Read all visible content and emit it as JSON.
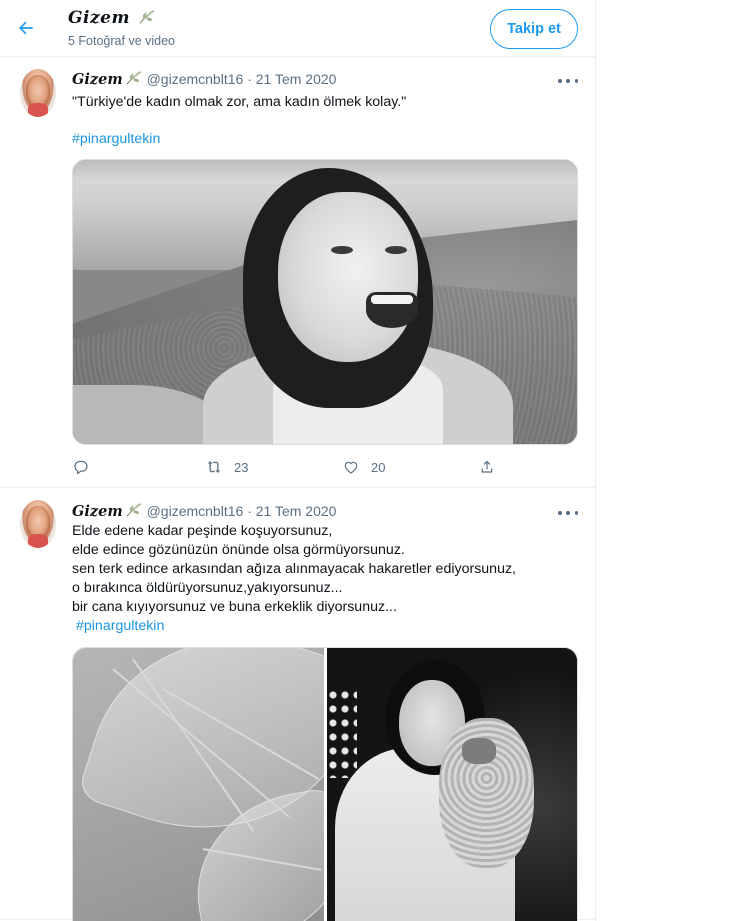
{
  "header": {
    "title": "Gizem",
    "subtitle": "5 Fotoğraf ve video",
    "follow_label": "Takip et"
  },
  "tweets": [
    {
      "display_name": "Gizem",
      "handle": "@gizemcnblt16",
      "separator": "·",
      "date": "21 Tem 2020",
      "text_lines": [
        "\"Türkiye'de kadın olmak zor, ama kadın ölmek kolay.\""
      ],
      "hashtag": "#pinargultekin",
      "replies": "",
      "retweets": "23",
      "likes": "20"
    },
    {
      "display_name": "Gizem",
      "handle": "@gizemcnblt16",
      "separator": "·",
      "date": "21 Tem 2020",
      "text_lines": [
        "Elde edene kadar peşinde koşuyorsunuz,",
        "elde edince gözünüzün önünde olsa görmüyorsunuz.",
        "sen terk edince arkasından ağıza alınmayacak hakaretler ediyorsunuz,",
        "o bırakınca öldürüyorsunuz,yakıyorsunuz...",
        "bir cana kıyıyorsunuz ve buna erkeklik diyorsunuz..."
      ],
      "hashtag": "#pinargultekin"
    }
  ],
  "icons": {
    "back": "arrow-left-icon",
    "leaf": "leaf-icon",
    "more": "more-horizontal-icon",
    "reply": "reply-icon",
    "retweet": "retweet-icon",
    "like": "heart-icon",
    "share": "share-icon"
  },
  "colors": {
    "accent": "#1d9bf0",
    "hashtag": "#1b95e0",
    "secondary_text": "#5b7083",
    "divider": "#ebeef0"
  }
}
